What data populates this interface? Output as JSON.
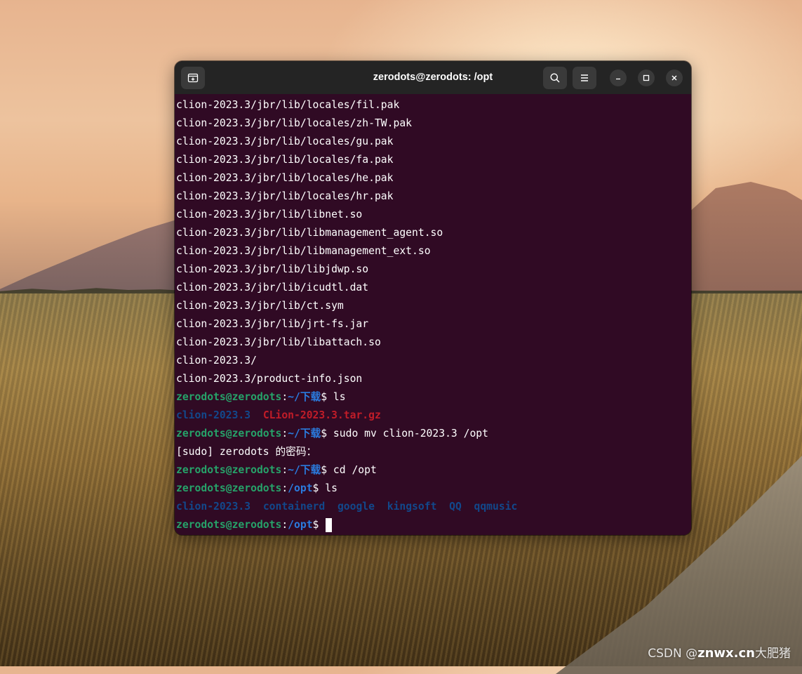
{
  "window": {
    "title": "zerodots@zerodots: /opt"
  },
  "icons": {
    "new_tab": "new-tab-icon",
    "search": "search-icon",
    "menu": "hamburger-menu-icon",
    "minimize": "minimize-icon",
    "maximize": "maximize-icon",
    "close": "close-icon"
  },
  "terminal": {
    "output_lines": [
      "clion-2023.3/jbr/lib/locales/fil.pak",
      "clion-2023.3/jbr/lib/locales/zh-TW.pak",
      "clion-2023.3/jbr/lib/locales/gu.pak",
      "clion-2023.3/jbr/lib/locales/fa.pak",
      "clion-2023.3/jbr/lib/locales/he.pak",
      "clion-2023.3/jbr/lib/locales/hr.pak",
      "clion-2023.3/jbr/lib/libnet.so",
      "clion-2023.3/jbr/lib/libmanagement_agent.so",
      "clion-2023.3/jbr/lib/libmanagement_ext.so",
      "clion-2023.3/jbr/lib/libjdwp.so",
      "clion-2023.3/jbr/lib/icudtl.dat",
      "clion-2023.3/jbr/lib/ct.sym",
      "clion-2023.3/jbr/lib/jrt-fs.jar",
      "clion-2023.3/jbr/lib/libattach.so",
      "clion-2023.3/",
      "clion-2023.3/product-info.json"
    ],
    "user_host": "zerodots@zerodots",
    "colon": ":",
    "dir_downloads": "~/下载",
    "dir_opt": "/opt",
    "prompt_symbol": "$",
    "cmd1": " ls",
    "ls1_dir": "clion-2023.3",
    "ls1_archive": "CLion-2023.3.tar.gz",
    "cmd2": " sudo mv clion-2023.3 /opt",
    "sudo_prompt": "[sudo] zerodots 的密码：",
    "cmd3": " cd /opt",
    "cmd4": " ls",
    "ls2_items": [
      "clion-2023.3",
      "containerd",
      "google",
      "kingsoft",
      "QQ",
      "qqmusic"
    ],
    "colors": {
      "background": "#300a24",
      "prompt_user": "#26a269",
      "prompt_path": "#2a7bde",
      "directory": "#12488b",
      "archive": "#c01c28"
    }
  },
  "desktop": {
    "watermark_prefix": "CSDN @",
    "watermark_brand": "znwx.cn",
    "watermark_suffix": "大肥猪"
  }
}
